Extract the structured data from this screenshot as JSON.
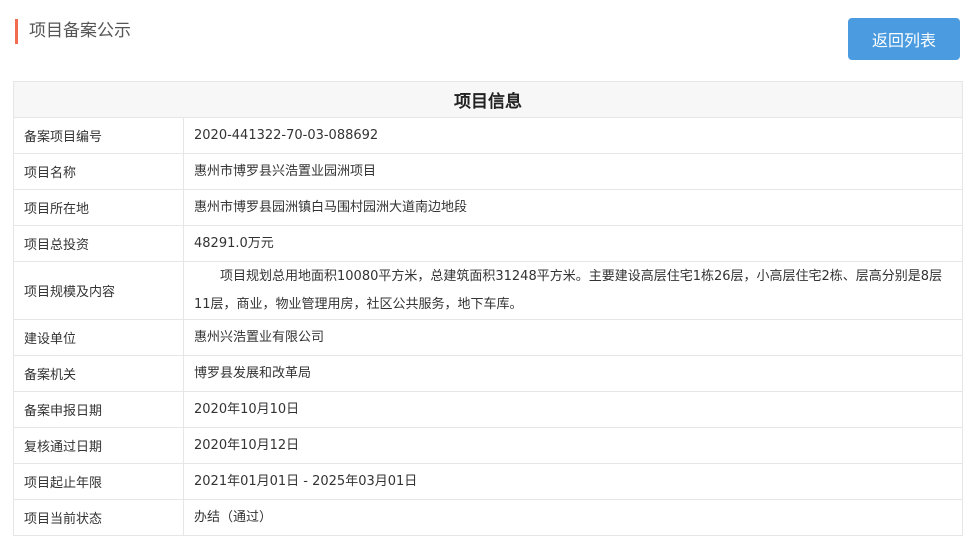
{
  "page_title": "项目备案公示",
  "back_button": "返回列表",
  "table_title": "项目信息",
  "rows": [
    {
      "label": "备案项目编号",
      "value": "2020-441322-70-03-088692"
    },
    {
      "label": "项目名称",
      "value": "惠州市博罗县兴浩置业园洲项目"
    },
    {
      "label": "项目所在地",
      "value": "惠州市博罗县园洲镇白马围村园洲大道南边地段"
    },
    {
      "label": "项目总投资",
      "value": "48291.0万元"
    },
    {
      "label": "项目规模及内容",
      "value": "项目规划总用地面积10080平方米，总建筑面积31248平方米。主要建设高层住宅1栋26层，小高层住宅2栋、层高分别是8层11层，商业，物业管理用房，社区公共服务，地下车库。"
    },
    {
      "label": "建设单位",
      "value": "惠州兴浩置业有限公司"
    },
    {
      "label": "备案机关",
      "value": "博罗县发展和改革局"
    },
    {
      "label": "备案申报日期",
      "value": "2020年10月10日"
    },
    {
      "label": "复核通过日期",
      "value": "2020年10月12日"
    },
    {
      "label": "项目起止年限",
      "value": "2021年01月01日 - 2025年03月01日"
    },
    {
      "label": "项目当前状态",
      "value": "办结（通过）"
    }
  ]
}
